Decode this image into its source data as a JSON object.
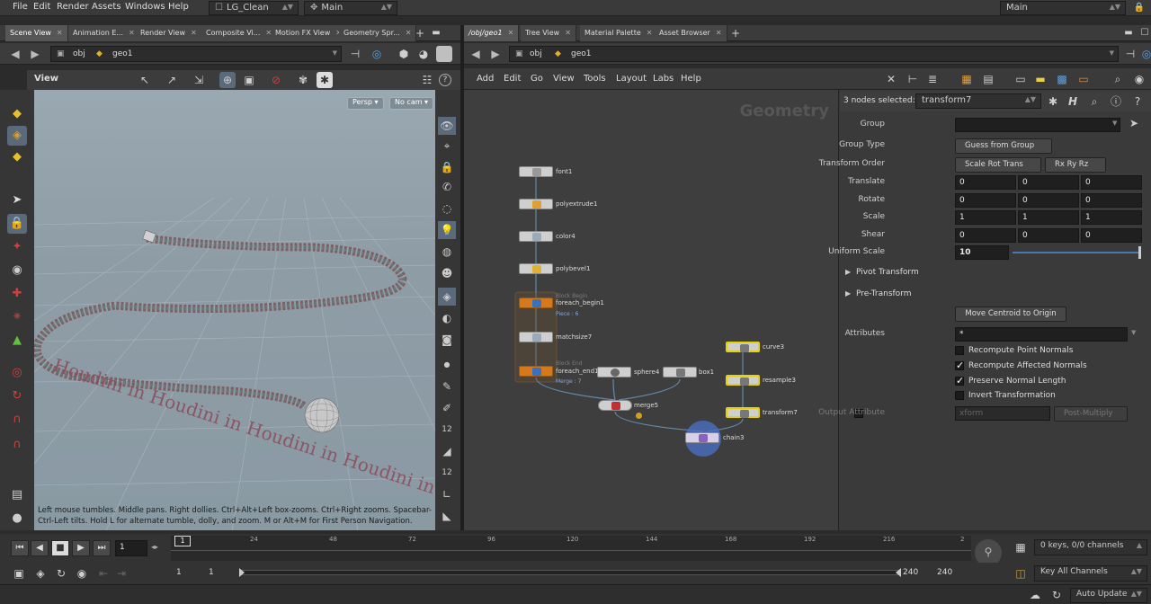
{
  "menu": {
    "items": [
      "File",
      "Edit",
      "Render",
      "Assets",
      "Windows",
      "Help"
    ],
    "desktop": "LG_Clean",
    "main": "Main",
    "right_main": "Main"
  },
  "left_pane": {
    "tabs": [
      "Scene View",
      "Animation E...",
      "Render View",
      "Composite Vi...",
      "Motion FX View",
      "Geometry Spr..."
    ],
    "path": {
      "obj": "obj",
      "geo": "geo1"
    },
    "view_label": "View",
    "persp": "Persp",
    "nocam": "No cam",
    "hint": "Left mouse tumbles. Middle pans. Right dollies. Ctrl+Alt+Left box-zooms. Ctrl+Right zooms. Spacebar-Ctrl-Left tilts. Hold L for alternate tumble, dolly, and zoom.    M or Alt+M for First Person Navigation.",
    "snake_text": "Houdini in Houdini in Houdini in Houdini in Houdini in Houdini in",
    "colors": {
      "sky_top": "#9aa8b2",
      "ground": "#8a9aa3"
    }
  },
  "right_pane": {
    "tabs": [
      "/obj/geo1",
      "Tree View",
      "Material Palette",
      "Asset Browser"
    ],
    "path": {
      "obj": "obj",
      "geo": "geo1"
    },
    "menu": [
      "Add",
      "Edit",
      "Go",
      "View",
      "Tools",
      "Layout",
      "Labs",
      "Help"
    ],
    "network_title": "Geometry",
    "nodes": [
      {
        "name": "font1"
      },
      {
        "name": "polyextrude1"
      },
      {
        "name": "color4"
      },
      {
        "name": "polybevel1"
      },
      {
        "name": "foreach_begin1",
        "top": "Block Begin",
        "sub": "Piece : 6"
      },
      {
        "name": "matchsize7"
      },
      {
        "name": "foreach_end1",
        "top": "Block End",
        "sub": "Merge : 7"
      },
      {
        "name": "sphere4"
      },
      {
        "name": "box1"
      },
      {
        "name": "merge5"
      },
      {
        "name": "curve3"
      },
      {
        "name": "resample3"
      },
      {
        "name": "transform7"
      },
      {
        "name": "chain3"
      }
    ]
  },
  "params": {
    "selected_text": "3 nodes selected:",
    "selected_node": "transform7",
    "group_label": "Group",
    "group_value": "",
    "group_type_label": "Group Type",
    "group_type_value": "Guess from Group",
    "order_label": "Transform Order",
    "order_value": "Scale Rot Trans",
    "rot_order": "Rx Ry Rz",
    "translate_label": "Translate",
    "translate": [
      "0",
      "0",
      "0"
    ],
    "rotate_label": "Rotate",
    "rotate": [
      "0",
      "0",
      "0"
    ],
    "scale_label": "Scale",
    "scale": [
      "1",
      "1",
      "1"
    ],
    "shear_label": "Shear",
    "shear": [
      "0",
      "0",
      "0"
    ],
    "uniform_label": "Uniform Scale",
    "uniform_value": "10",
    "pivot_label": "Pivot Transform",
    "pre_label": "Pre-Transform",
    "move_centroid": "Move Centroid to Origin",
    "attributes_label": "Attributes",
    "attributes_value": "*",
    "checks": [
      {
        "label": "Recompute Point Normals",
        "on": false
      },
      {
        "label": "Recompute Affected Normals",
        "on": true
      },
      {
        "label": "Preserve Normal Length",
        "on": true
      },
      {
        "label": "Invert Transformation",
        "on": false
      }
    ],
    "output_attr_label": "Output Attribute",
    "output_attr_value": "xform",
    "output_mode": "Post-Multiply"
  },
  "timeline": {
    "frame": "1",
    "ticks": [
      "1",
      "24",
      "48",
      "72",
      "96",
      "120",
      "144",
      "168",
      "192",
      "216",
      "2"
    ],
    "current_marker": "1",
    "start": "1",
    "start2": "1",
    "end": "240",
    "end2": "240",
    "keys": "0 keys, 0/0 channels",
    "key_all": "Key All Channels",
    "auto_update": "Auto Update"
  }
}
